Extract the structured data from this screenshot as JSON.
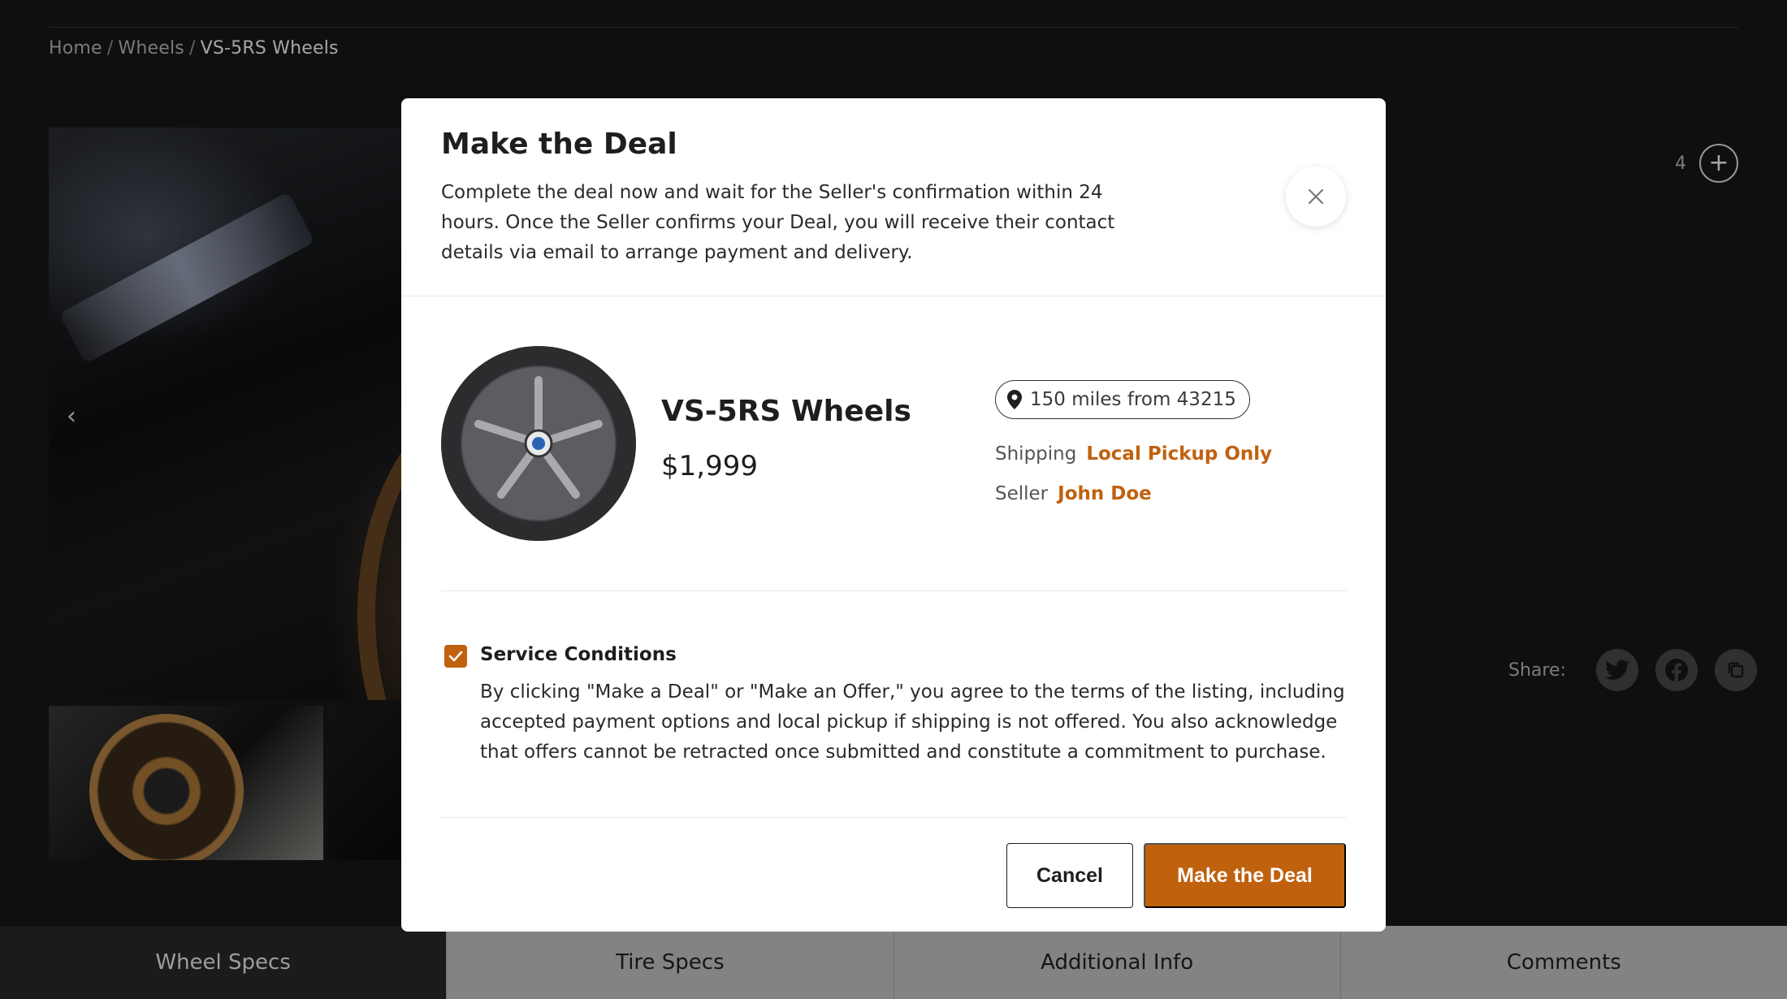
{
  "breadcrumb": {
    "items": [
      "Home",
      "Wheels"
    ],
    "separator": "/",
    "current": "VS-5RS Wheels"
  },
  "gallery": {
    "image_count": "4",
    "zoom_icon": "plus-icon",
    "prev_icon": "chevron-left-icon"
  },
  "share": {
    "label": "Share:",
    "icons": [
      "twitter-icon",
      "facebook-icon",
      "copy-icon"
    ]
  },
  "tabs": [
    {
      "label": "Wheel Specs",
      "active": true
    },
    {
      "label": "Tire Specs",
      "active": false
    },
    {
      "label": "Additional Info",
      "active": false
    },
    {
      "label": "Comments",
      "active": false
    }
  ],
  "modal": {
    "title": "Make the Deal",
    "description": "Complete the deal now and wait for the Seller's confirmation within 24 hours. Once the Seller confirms your Deal, you will receive their contact details via email to arrange payment and delivery.",
    "close_icon": "close-icon",
    "product": {
      "name": "VS-5RS Wheels",
      "price": "$1,999"
    },
    "distance": "150 miles from 43215",
    "shipping_label": "Shipping",
    "shipping_value": "Local Pickup Only",
    "seller_label": "Seller",
    "seller_value": "John Doe",
    "conditions": {
      "checked": true,
      "title": "Service Conditions",
      "text": "By clicking \"Make a Deal\" or \"Make an Offer,\" you agree to the terms of the listing, including accepted payment options and local pickup if shipping is not offered. You also acknowledge that offers cannot be retracted once submitted and constitute a commitment to purchase."
    },
    "cancel_label": "Cancel",
    "confirm_label": "Make the Deal"
  },
  "colors": {
    "accent": "#c0610e",
    "background": "#171717",
    "modal_bg": "#ffffff"
  }
}
